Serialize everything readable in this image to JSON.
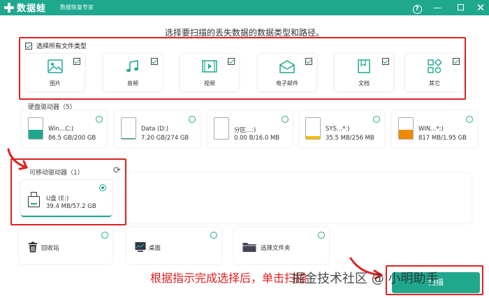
{
  "app": {
    "name": "数据蛙",
    "subtitle": "数据恢复专家"
  },
  "instruction": "选择要扫描的丢失数据的数据类型和路径。",
  "file_types": {
    "select_all_label": "选择所有文件类型",
    "items": [
      {
        "label": "图片",
        "icon": "image-icon",
        "checked": true
      },
      {
        "label": "音频",
        "icon": "music-icon",
        "checked": true
      },
      {
        "label": "视频",
        "icon": "video-icon",
        "checked": true
      },
      {
        "label": "电子邮件",
        "icon": "email-icon",
        "checked": true
      },
      {
        "label": "文档",
        "icon": "document-icon",
        "checked": true
      },
      {
        "label": "其它",
        "icon": "other-icon",
        "checked": true
      }
    ]
  },
  "hard_drives": {
    "label": "硬盘驱动器（5）",
    "items": [
      {
        "name": "Win...C:)",
        "size": "86.5 GB/200 GB",
        "fill": 0.43,
        "color": "#20a88f"
      },
      {
        "name": "Data (D:)",
        "size": "7.20 GB/274 GB",
        "fill": 0.03,
        "color": "#20a88f"
      },
      {
        "name": "分区...:)",
        "size": "0.00  B/16.0 MB",
        "fill": 0.0,
        "color": "#20a88f"
      },
      {
        "name": "SYS...*:)",
        "size": "35.5 MB/256 MB",
        "fill": 0.14,
        "color": "#f5c000"
      },
      {
        "name": "WIN...*:)",
        "size": "817 MB/1.95 GB",
        "fill": 0.42,
        "color": "#f08a00"
      }
    ]
  },
  "removable": {
    "label": "可移动驱动器（1）",
    "items": [
      {
        "name": "U盘 (E:)",
        "size": "39.4 MB/57.2 GB",
        "selected": true
      }
    ]
  },
  "locations": [
    {
      "label": "回收站",
      "icon": "recycle-bin-icon"
    },
    {
      "label": "桌面",
      "icon": "desktop-icon"
    },
    {
      "label": "选择文件夹",
      "icon": "folder-icon"
    }
  ],
  "hint": "根据指示完成选择后，单击扫描",
  "watermark": "掘金技术社区 @ 小明助手",
  "scan_button": "扫描",
  "colors": {
    "accent": "#20a88f",
    "highlight": "#e02020"
  }
}
